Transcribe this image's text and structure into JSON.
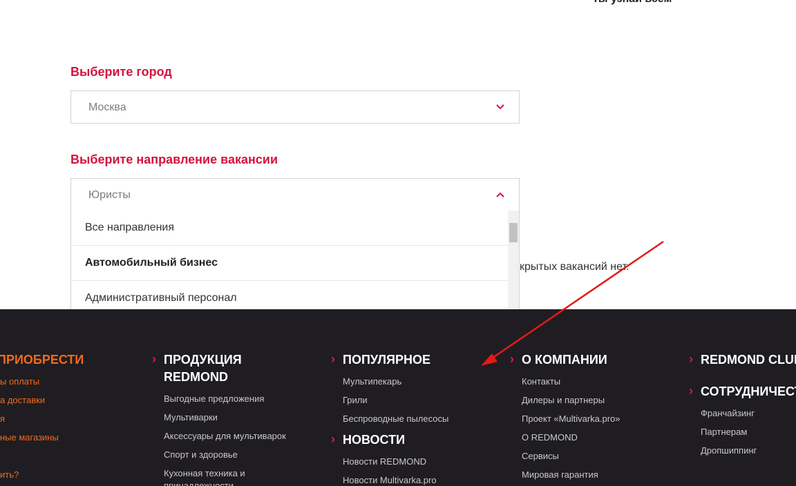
{
  "top_fragment": "ты узнай всем",
  "city": {
    "label": "Выберите город",
    "selected": "Москва"
  },
  "direction": {
    "label": "Выберите направление вакансии",
    "selected": "Юристы",
    "options": [
      "Все направления",
      "Автомобильный бизнес",
      "Административный персонал"
    ]
  },
  "no_vacancies_text": "крытых вакансий нет.",
  "footer": {
    "col1": {
      "title": "ПРИОБРЕСТИ",
      "links": [
        "ы оплаты",
        "а доставки",
        "я",
        "ные магазины",
        "",
        "ить?"
      ]
    },
    "col2": {
      "title_line1": "ПРОДУКЦИЯ",
      "title_line2": "REDMOND",
      "links": [
        "Выгодные предложения",
        "Мультиварки",
        "Аксессуары для мультиварок",
        "Спорт и здоровье",
        "Кухонная техника и",
        "принадлежности"
      ]
    },
    "col3": {
      "title": "ПОПУЛЯРНОЕ",
      "links": [
        "Мультипекарь",
        "Грили",
        "Беспроводные пылесосы"
      ],
      "title2": "НОВОСТИ",
      "links2": [
        "Новости REDMOND",
        "Новости Multivarka.pro"
      ]
    },
    "col4": {
      "title": "О КОМПАНИИ",
      "links": [
        "Контакты",
        "Дилеры и партнеры",
        "Проект «Multivarka.pro»",
        "О REDMOND",
        "Сервисы",
        "Мировая гарантия"
      ]
    },
    "col5": {
      "title": "REDMOND CLUB",
      "title2": "СОТРУДНИЧЕСТВО",
      "links2": [
        "Франчайзинг",
        "Партнерам",
        "Дропшиппинг"
      ]
    }
  },
  "colors": {
    "accent": "#d5133f",
    "footer_bg": "#1f1d22",
    "orange": "#f26a1b",
    "arrow": "#e41a1a"
  }
}
